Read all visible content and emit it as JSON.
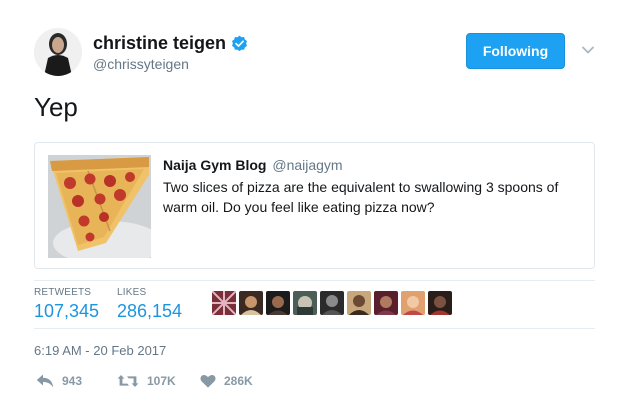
{
  "author": {
    "name": "christine teigen",
    "handle": "@chrissyteigen",
    "verified": true
  },
  "follow_button": {
    "label": "Following",
    "color": "#1da1f2"
  },
  "tweet": {
    "text": "Yep"
  },
  "quoted_tweet": {
    "author": "Naija Gym Blog",
    "handle": "@naijagym",
    "text": "Two slices of pizza are the equivalent to swallowing 3 spoons of warm oil. Do you feel like eating pizza now?",
    "image_icon": "pizza-image"
  },
  "stats": {
    "retweets_label": "RETWEETS",
    "retweets_value": "107,345",
    "likes_label": "LIKES",
    "likes_value": "286,154",
    "liker_count": 9
  },
  "timestamp": "6:19 AM - 20 Feb 2017",
  "actions": {
    "reply": {
      "icon": "reply-icon",
      "count": "943"
    },
    "retweet": {
      "icon": "retweet-icon",
      "count": "107K"
    },
    "like": {
      "icon": "heart-icon",
      "count": "286K"
    }
  },
  "colors": {
    "link": "#1b95e0",
    "muted": "#657786",
    "icon": "#8899a6",
    "verified": "#1da1f2"
  }
}
